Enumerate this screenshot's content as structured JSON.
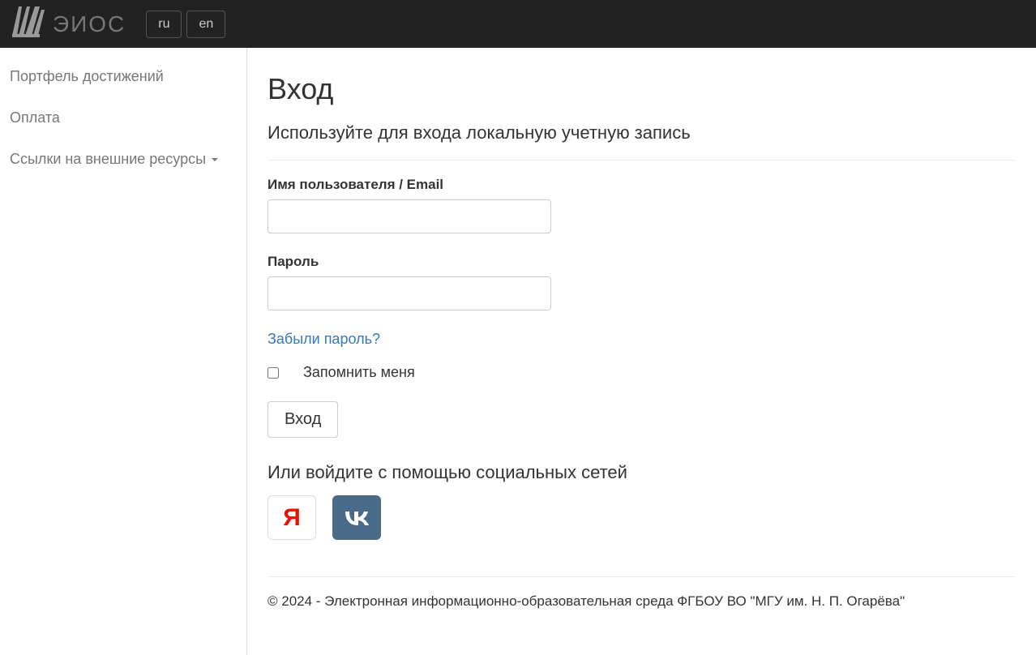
{
  "navbar": {
    "brand": "ЭИОС",
    "lang_ru": "ru",
    "lang_en": "en"
  },
  "sidebar": {
    "items": [
      {
        "label": "Портфель достижений",
        "has_dropdown": false
      },
      {
        "label": "Оплата",
        "has_dropdown": false
      },
      {
        "label": "Ссылки на внешние ресурсы",
        "has_dropdown": true
      }
    ]
  },
  "login": {
    "title": "Вход",
    "subtitle": "Используйте для входа локальную учетную запись",
    "username_label": "Имя пользователя / Email",
    "username_value": "",
    "password_label": "Пароль",
    "password_value": "",
    "forgot_password": "Забыли пароль?",
    "remember_label": "Запомнить меня",
    "submit_label": "Вход",
    "social_title": "Или войдите с помощью социальных сетей"
  },
  "footer": {
    "text": "© 2024 - Электронная информационно-образовательная среда ФГБОУ ВО \"МГУ им. Н. П. Огарёва\""
  }
}
